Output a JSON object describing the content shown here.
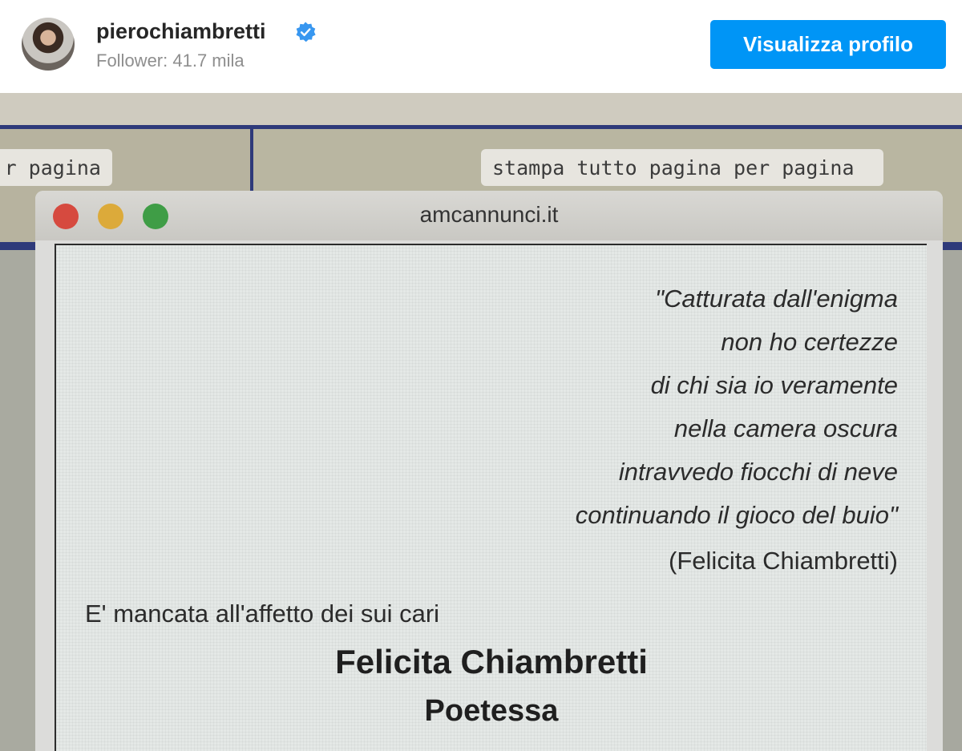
{
  "header": {
    "username": "pierochiambretti",
    "followers": "Follower: 41.7 mila",
    "profile_button": "Visualizza profilo",
    "verified_icon": "verified-badge-icon",
    "accent_color": "#0095f6"
  },
  "photo": {
    "chip_left": "r pagina",
    "chip_right": "stampa tutto pagina per pagina",
    "window_title": "amcannunci.it",
    "poem_lines": [
      "\"Catturata dall'enigma",
      "non ho certezze",
      "di chi sia io veramente",
      "nella camera oscura",
      "intravvedo fiocchi di neve",
      "continuando il gioco del buio\""
    ],
    "attribution": "(Felicita Chiambretti)",
    "intro": "E' mancata all'affetto dei sui cari",
    "name": "Felicita Chiambretti",
    "role": "Poetessa"
  }
}
